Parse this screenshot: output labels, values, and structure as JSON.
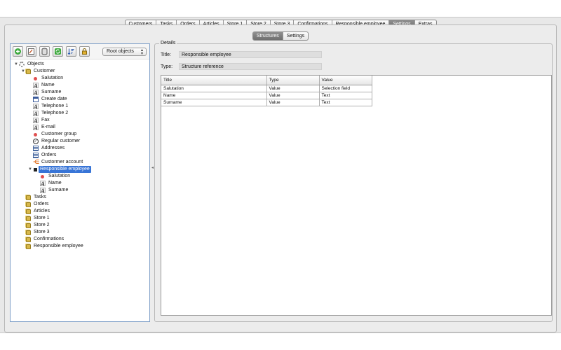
{
  "main_tabs": [
    {
      "label": "Customers",
      "active": false
    },
    {
      "label": "Tasks",
      "active": false
    },
    {
      "label": "Orders",
      "active": false
    },
    {
      "label": "Articles",
      "active": false
    },
    {
      "label": "Store 1",
      "active": false
    },
    {
      "label": "Store 2",
      "active": false
    },
    {
      "label": "Store 3",
      "active": false
    },
    {
      "label": "Confirmations",
      "active": false
    },
    {
      "label": "Responsible employee",
      "active": false
    },
    {
      "label": "Settings",
      "active": true
    },
    {
      "label": "Extras",
      "active": false
    }
  ],
  "sub_tabs": [
    {
      "label": "Structures",
      "active": true
    },
    {
      "label": "Settings",
      "active": false
    }
  ],
  "toolbar": {
    "buttons": [
      "add-icon",
      "edit-icon",
      "database-icon",
      "refresh-icon",
      "sort-icon",
      "lock-icon"
    ],
    "select_value": "Root objects"
  },
  "tree": [
    {
      "label": "Objects",
      "level": 0,
      "icon": "gear-icon",
      "expanded": true
    },
    {
      "label": "Customer",
      "level": 1,
      "icon": "folder-icon",
      "expanded": true
    },
    {
      "label": "Salutation",
      "level": 2,
      "icon": "selection-icon"
    },
    {
      "label": "Name",
      "level": 2,
      "icon": "text-icon"
    },
    {
      "label": "Surname",
      "level": 2,
      "icon": "text-icon"
    },
    {
      "label": "Create date",
      "level": 2,
      "icon": "calendar-icon"
    },
    {
      "label": "Telephone 1",
      "level": 2,
      "icon": "text-icon"
    },
    {
      "label": "Telephone 2",
      "level": 2,
      "icon": "text-icon"
    },
    {
      "label": "Fax",
      "level": 2,
      "icon": "text-icon"
    },
    {
      "label": "E-mail",
      "level": 2,
      "icon": "text-icon"
    },
    {
      "label": "Customer group",
      "level": 2,
      "icon": "selection-icon"
    },
    {
      "label": "Regular customer",
      "level": 2,
      "icon": "checkbox-icon"
    },
    {
      "label": "Addresses",
      "level": 2,
      "icon": "list-icon"
    },
    {
      "label": "Orders",
      "level": 2,
      "icon": "list-icon"
    },
    {
      "label": "Custormer account",
      "level": 2,
      "icon": "link-icon"
    },
    {
      "label": "Responsible employee",
      "level": 2,
      "icon": "reference-icon",
      "expanded": true,
      "selected": true
    },
    {
      "label": "Salutation",
      "level": 3,
      "icon": "selection-icon"
    },
    {
      "label": "Name",
      "level": 3,
      "icon": "text-icon"
    },
    {
      "label": "Surname",
      "level": 3,
      "icon": "text-icon"
    },
    {
      "label": "Tasks",
      "level": 1,
      "icon": "folder-icon"
    },
    {
      "label": "Orders",
      "level": 1,
      "icon": "folder-icon"
    },
    {
      "label": "Articles",
      "level": 1,
      "icon": "folder-icon"
    },
    {
      "label": "Store 1",
      "level": 1,
      "icon": "folder-icon"
    },
    {
      "label": "Store 2",
      "level": 1,
      "icon": "folder-icon"
    },
    {
      "label": "Store 3",
      "level": 1,
      "icon": "folder-icon"
    },
    {
      "label": "Confirmations",
      "level": 1,
      "icon": "folder-icon"
    },
    {
      "label": "Responsible employee",
      "level": 1,
      "icon": "folder-icon"
    }
  ],
  "details": {
    "legend": "Details",
    "title_label": "Title:",
    "title_value": "Responsible employee",
    "type_label": "Type:",
    "type_value": "Structure reference"
  },
  "table": {
    "columns": [
      "Title",
      "Type",
      "Value"
    ],
    "rows": [
      [
        "Salutation",
        "Value",
        "Selection field"
      ],
      [
        "Name",
        "Value",
        "Text"
      ],
      [
        "Surname",
        "Value",
        "Text"
      ]
    ]
  },
  "colors": {
    "selection": "#3875d7",
    "active_tab": "#7f7f7f",
    "panel_border": "#7fa0c8"
  }
}
